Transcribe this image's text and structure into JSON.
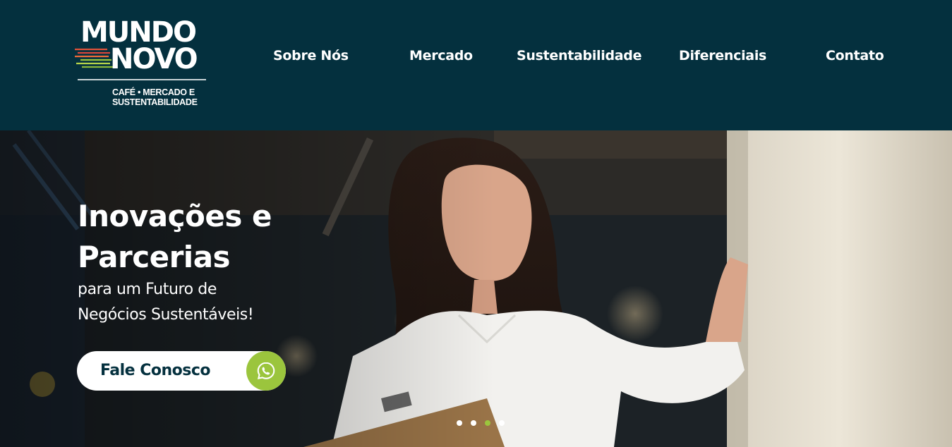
{
  "brand": {
    "line1": "MUNDO",
    "line2": "NOVO",
    "tagline1": "CAFÉ • MERCADO E",
    "tagline2": "SUSTENTABILIDADE"
  },
  "nav": {
    "items": [
      {
        "label": "Sobre Nós"
      },
      {
        "label": "Mercado"
      },
      {
        "label": "Sustentabilidade"
      },
      {
        "label": "Diferenciais"
      },
      {
        "label": "Contato"
      }
    ]
  },
  "hero": {
    "title_line1": "Inovações e",
    "title_line2": "Parcerias",
    "subtitle_line1": "para um Futuro de",
    "subtitle_line2": "Negócios Sustentáveis!",
    "cta_label": "Fale Conosco",
    "cta_icon": "whatsapp-icon",
    "slides_total": 4,
    "active_slide": 3
  },
  "colors": {
    "header_bg": "#04303e",
    "accent": "#9bc53d",
    "text": "#ffffff"
  }
}
